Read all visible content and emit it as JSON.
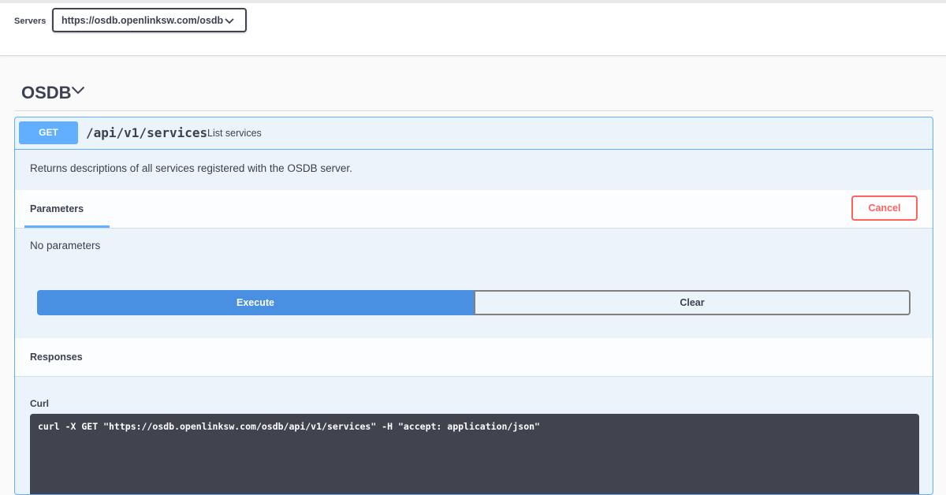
{
  "servers": {
    "label": "Servers",
    "selected": "https://osdb.openlinksw.com/osdb"
  },
  "tag": {
    "title": "OSDB"
  },
  "operation": {
    "method": "GET",
    "path": "/api/v1/services",
    "summary": "List services",
    "description": "Returns descriptions of all services registered with the OSDB server.",
    "parameters_tab": "Parameters",
    "cancel_label": "Cancel",
    "no_parameters": "No parameters",
    "execute_label": "Execute",
    "clear_label": "Clear",
    "responses_title": "Responses",
    "curl_label": "Curl",
    "curl_command": "curl -X GET \"https://osdb.openlinksw.com/osdb/api/v1/services\" -H \"accept: application/json\""
  },
  "colors": {
    "get_blue": "#61affe",
    "execute_blue": "#4990e2",
    "cancel_red": "#ff6060",
    "code_bg": "#41444e"
  },
  "icons": {
    "server_dropdown": "chevron-down-icon",
    "tag_toggle": "chevron-down-icon"
  }
}
